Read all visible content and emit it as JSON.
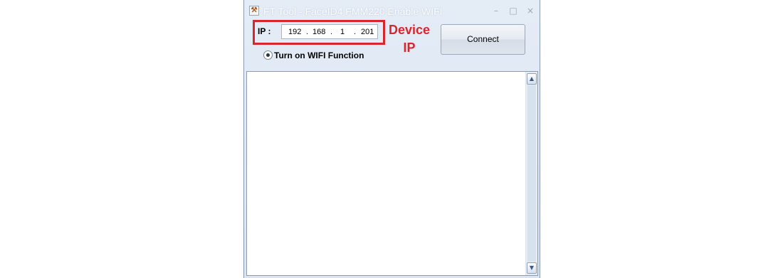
{
  "window": {
    "title": "FT Tool - FaceID4 FMM220 Enable WIFI",
    "app_icon_glyph": "⚒",
    "minimize_glyph": "–",
    "maximize_glyph": "□",
    "close_glyph": "×"
  },
  "ip": {
    "label": "IP :",
    "octet1": "192",
    "octet2": "168",
    "octet3": "1",
    "octet4": "201",
    "separator": "."
  },
  "annotation": {
    "line1": "Device",
    "line2": "IP",
    "color": "#d8262e"
  },
  "connect_button": {
    "label": "Connect"
  },
  "wifi_option": {
    "label": "Turn on WIFI Function",
    "selected": true
  },
  "scrollbar": {
    "up_glyph": "▲",
    "down_glyph": "▼"
  }
}
